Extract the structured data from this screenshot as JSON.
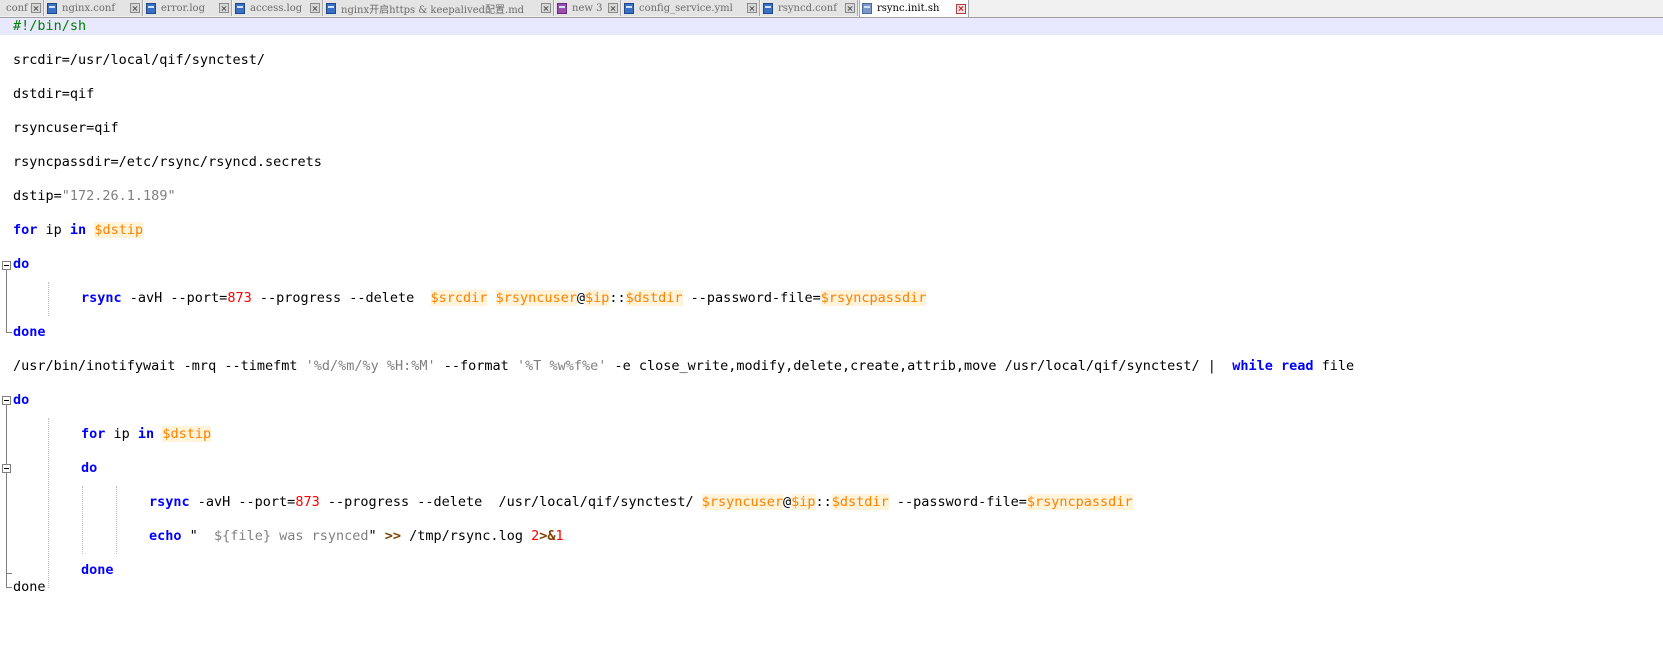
{
  "tabs": [
    {
      "label": "conf",
      "active": false
    },
    {
      "label": "nginx.conf",
      "active": false
    },
    {
      "label": "error.log",
      "active": false
    },
    {
      "label": "access.log",
      "active": false
    },
    {
      "label": "nginx开启https & keepalived配置.md",
      "active": false
    },
    {
      "label": "new 3",
      "active": false
    },
    {
      "label": "config_service.yml",
      "active": false
    },
    {
      "label": "rsyncd.conf",
      "active": false
    },
    {
      "label": "rsync.init.sh",
      "active": true
    }
  ],
  "code": {
    "shebang": "#!/bin/sh",
    "srcdir": "srcdir=/usr/local/qif/synctest/",
    "dstdir": "dstdir=qif",
    "rsyncuser": "rsyncuser=qif",
    "rsyncpassdir": "rsyncpassdir=/etc/rsync/rsyncd.secrets",
    "dstip_name": "dstip=",
    "dstip_value": "\"172.26.1.189\"",
    "kw_for": "for",
    "ip": " ip ",
    "kw_in": "in",
    "var_dstip": "$dstip",
    "kw_do": "do",
    "kw_done": "done",
    "plain_done": "done",
    "rsync": "rsync",
    "avH_port": " -avH --port=",
    "port": "873",
    "progress_delete": " --progress --delete  ",
    "var_srcdir": "$srcdir",
    "space": " ",
    "var_rsyncuser": "$rsyncuser",
    "at": "@",
    "var_ip": "$ip",
    "colons": "::",
    "var_dstdir": "$dstdir",
    "password_file": " --password-file=",
    "var_rsyncpassdir": "$rsyncpassdir",
    "inotify_a": "/usr/bin/inotifywait -mrq --timefmt ",
    "timefmt": "'%d/%m/%y %H:%M'",
    "format_flag": " --format ",
    "format": "'%T %w%f%e'",
    "inotify_b": " -e close_write,modify,delete,create,attrib,move /usr/local/qif/synctest/ | ",
    "kw_while": "while",
    "kw_read": "read",
    "file": " file",
    "sync_path": "/usr/local/qif/synctest/ ",
    "echo": "echo",
    "echo_str_a": "\"",
    "echo_str_b": "  ${file} was rsynced",
    "echo_str_c": "\"",
    "redirect": ">>",
    "logfile": " /tmp/rsync.log ",
    "two": "2",
    "redir2": ">&",
    "one": "1"
  }
}
